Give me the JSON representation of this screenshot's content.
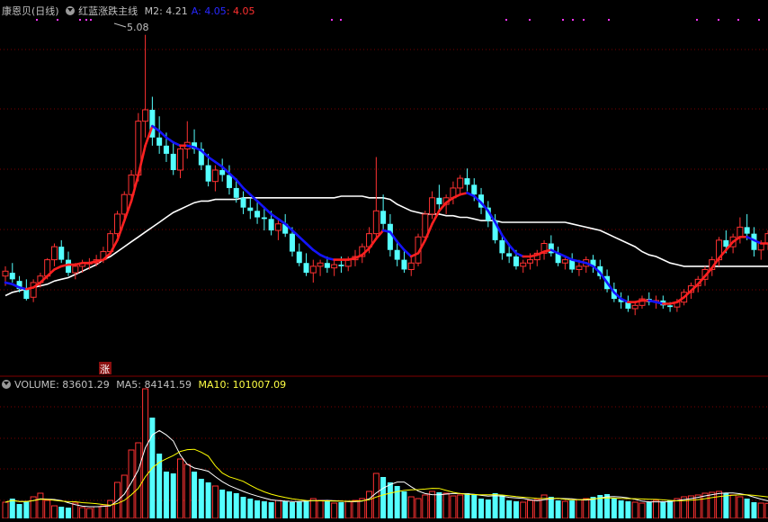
{
  "header": {
    "stock_name": "康恩贝(日线)",
    "indicator_name": "红蓝涨跌主线",
    "m2_label": "M2: 4.21",
    "a_label": "A: 4.05",
    "b_label": ": 4.05"
  },
  "annotations": {
    "high_label": "5.08",
    "zhang_marker": "涨"
  },
  "volume_header": {
    "volume_label": "VOLUME: 83601.29",
    "ma5_label": "MA5: 84141.59",
    "ma10_label": "MA10: 101007.09"
  },
  "colors": {
    "up": "#ff3232",
    "down": "#54ffff",
    "main_red": "#ff2020",
    "main_blue": "#1414ff",
    "long_ma": "#ffffff",
    "grid": "#7a0000",
    "dots": "#ff33ff",
    "ma10": "#ffff00",
    "ma5": "#ffffff"
  },
  "chart_data": [
    {
      "type": "candlestick",
      "price_range": [
        3.35,
        5.15
      ],
      "series": [
        {
          "name": "K",
          "ohlc": [
            [
              3.6,
              3.66,
              3.54,
              3.63
            ],
            [
              3.62,
              3.68,
              3.56,
              3.58
            ],
            [
              3.57,
              3.6,
              3.5,
              3.52
            ],
            [
              3.52,
              3.58,
              3.45,
              3.46
            ],
            [
              3.47,
              3.58,
              3.44,
              3.56
            ],
            [
              3.56,
              3.62,
              3.53,
              3.6
            ],
            [
              3.6,
              3.71,
              3.58,
              3.7
            ],
            [
              3.7,
              3.8,
              3.66,
              3.78
            ],
            [
              3.78,
              3.82,
              3.68,
              3.7
            ],
            [
              3.7,
              3.75,
              3.6,
              3.62
            ],
            [
              3.62,
              3.68,
              3.58,
              3.66
            ],
            [
              3.66,
              3.7,
              3.62,
              3.68
            ],
            [
              3.68,
              3.71,
              3.64,
              3.68
            ],
            [
              3.68,
              3.73,
              3.66,
              3.7
            ],
            [
              3.7,
              3.78,
              3.68,
              3.75
            ],
            [
              3.75,
              3.88,
              3.73,
              3.86
            ],
            [
              3.86,
              4.0,
              3.84,
              3.98
            ],
            [
              3.98,
              4.12,
              3.95,
              4.1
            ],
            [
              4.1,
              4.25,
              4.05,
              4.22
            ],
            [
              4.22,
              4.6,
              4.18,
              4.55
            ],
            [
              4.55,
              5.08,
              4.45,
              4.62
            ],
            [
              4.62,
              4.7,
              4.4,
              4.45
            ],
            [
              4.45,
              4.58,
              4.35,
              4.4
            ],
            [
              4.4,
              4.48,
              4.3,
              4.35
            ],
            [
              4.35,
              4.42,
              4.22,
              4.25
            ],
            [
              4.25,
              4.4,
              4.2,
              4.38
            ],
            [
              4.38,
              4.55,
              4.32,
              4.42
            ],
            [
              4.42,
              4.5,
              4.35,
              4.38
            ],
            [
              4.38,
              4.42,
              4.25,
              4.28
            ],
            [
              4.28,
              4.35,
              4.15,
              4.18
            ],
            [
              4.18,
              4.28,
              4.12,
              4.25
            ],
            [
              4.25,
              4.32,
              4.18,
              4.22
            ],
            [
              4.22,
              4.28,
              4.1,
              4.14
            ],
            [
              4.14,
              4.2,
              4.05,
              4.08
            ],
            [
              4.08,
              4.12,
              3.98,
              4.02
            ],
            [
              4.02,
              4.08,
              3.95,
              4.0
            ],
            [
              4.0,
              4.05,
              3.92,
              3.96
            ],
            [
              3.96,
              4.02,
              3.88,
              3.95
            ],
            [
              3.95,
              4.0,
              3.85,
              3.88
            ],
            [
              3.88,
              3.95,
              3.82,
              3.92
            ],
            [
              3.92,
              3.98,
              3.84,
              3.86
            ],
            [
              3.86,
              3.9,
              3.72,
              3.75
            ],
            [
              3.75,
              3.8,
              3.66,
              3.68
            ],
            [
              3.68,
              3.74,
              3.6,
              3.62
            ],
            [
              3.62,
              3.7,
              3.56,
              3.66
            ],
            [
              3.66,
              3.7,
              3.6,
              3.68
            ],
            [
              3.68,
              3.72,
              3.62,
              3.65
            ],
            [
              3.65,
              3.7,
              3.6,
              3.67
            ],
            [
              3.67,
              3.72,
              3.62,
              3.66
            ],
            [
              3.66,
              3.72,
              3.63,
              3.7
            ],
            [
              3.7,
              3.76,
              3.66,
              3.72
            ],
            [
              3.72,
              3.8,
              3.68,
              3.78
            ],
            [
              3.78,
              3.9,
              3.74,
              3.86
            ],
            [
              3.86,
              4.33,
              3.82,
              4.0
            ],
            [
              4.0,
              4.1,
              3.88,
              3.92
            ],
            [
              3.92,
              3.98,
              3.72,
              3.76
            ],
            [
              3.76,
              3.82,
              3.66,
              3.7
            ],
            [
              3.7,
              3.76,
              3.62,
              3.64
            ],
            [
              3.64,
              3.72,
              3.6,
              3.68
            ],
            [
              3.68,
              3.86,
              3.66,
              3.84
            ],
            [
              3.84,
              4.0,
              3.82,
              3.98
            ],
            [
              3.98,
              4.12,
              3.95,
              4.08
            ],
            [
              4.08,
              4.16,
              4.0,
              4.04
            ],
            [
              4.04,
              4.1,
              3.98,
              4.08
            ],
            [
              4.08,
              4.18,
              4.04,
              4.14
            ],
            [
              4.14,
              4.22,
              4.1,
              4.2
            ],
            [
              4.2,
              4.26,
              4.12,
              4.16
            ],
            [
              4.16,
              4.2,
              4.06,
              4.1
            ],
            [
              4.1,
              4.14,
              3.98,
              4.02
            ],
            [
              4.02,
              4.06,
              3.9,
              3.94
            ],
            [
              3.94,
              3.98,
              3.8,
              3.82
            ],
            [
              3.82,
              3.86,
              3.7,
              3.74
            ],
            [
              3.74,
              3.8,
              3.68,
              3.72
            ],
            [
              3.72,
              3.76,
              3.64,
              3.66
            ],
            [
              3.66,
              3.7,
              3.62,
              3.68
            ],
            [
              3.68,
              3.74,
              3.64,
              3.7
            ],
            [
              3.7,
              3.76,
              3.66,
              3.74
            ],
            [
              3.74,
              3.82,
              3.7,
              3.8
            ],
            [
              3.8,
              3.85,
              3.72,
              3.74
            ],
            [
              3.74,
              3.78,
              3.66,
              3.68
            ],
            [
              3.68,
              3.72,
              3.64,
              3.7
            ],
            [
              3.7,
              3.74,
              3.62,
              3.64
            ],
            [
              3.64,
              3.7,
              3.6,
              3.66
            ],
            [
              3.66,
              3.72,
              3.62,
              3.7
            ],
            [
              3.7,
              3.73,
              3.62,
              3.66
            ],
            [
              3.66,
              3.7,
              3.58,
              3.6
            ],
            [
              3.6,
              3.64,
              3.5,
              3.52
            ],
            [
              3.52,
              3.56,
              3.44,
              3.46
            ],
            [
              3.46,
              3.5,
              3.4,
              3.44
            ],
            [
              3.44,
              3.48,
              3.38,
              3.4
            ],
            [
              3.4,
              3.44,
              3.36,
              3.42
            ],
            [
              3.42,
              3.48,
              3.4,
              3.46
            ],
            [
              3.46,
              3.5,
              3.42,
              3.44
            ],
            [
              3.44,
              3.48,
              3.4,
              3.45
            ],
            [
              3.45,
              3.48,
              3.4,
              3.42
            ],
            [
              3.42,
              3.44,
              3.38,
              3.41
            ],
            [
              3.41,
              3.46,
              3.38,
              3.44
            ],
            [
              3.44,
              3.52,
              3.42,
              3.5
            ],
            [
              3.5,
              3.56,
              3.46,
              3.54
            ],
            [
              3.54,
              3.6,
              3.5,
              3.58
            ],
            [
              3.58,
              3.66,
              3.54,
              3.64
            ],
            [
              3.64,
              3.72,
              3.6,
              3.7
            ],
            [
              3.7,
              3.84,
              3.66,
              3.82
            ],
            [
              3.82,
              3.88,
              3.74,
              3.78
            ],
            [
              3.78,
              3.86,
              3.74,
              3.84
            ],
            [
              3.84,
              3.96,
              3.8,
              3.9
            ],
            [
              3.9,
              3.98,
              3.82,
              3.86
            ],
            [
              3.86,
              3.9,
              3.72,
              3.76
            ],
            [
              3.76,
              3.82,
              3.7,
              3.8
            ],
            [
              3.8,
              3.88,
              3.76,
              3.86
            ]
          ]
        }
      ]
    },
    {
      "type": "line",
      "title": "红蓝涨跌主线",
      "series": [
        {
          "name": "A",
          "values": [
            3.56,
            3.55,
            3.53,
            3.52,
            3.53,
            3.56,
            3.6,
            3.64,
            3.66,
            3.67,
            3.67,
            3.68,
            3.68,
            3.69,
            3.7,
            3.74,
            3.82,
            3.94,
            4.06,
            4.22,
            4.4,
            4.52,
            4.49,
            4.45,
            4.42,
            4.4,
            4.4,
            4.39,
            4.37,
            4.33,
            4.3,
            4.27,
            4.23,
            4.19,
            4.14,
            4.1,
            4.06,
            4.02,
            3.98,
            3.95,
            3.92,
            3.88,
            3.84,
            3.8,
            3.76,
            3.73,
            3.71,
            3.7,
            3.7,
            3.7,
            3.71,
            3.73,
            3.77,
            3.83,
            3.88,
            3.87,
            3.81,
            3.76,
            3.72,
            3.74,
            3.82,
            3.92,
            4.0,
            4.05,
            4.08,
            4.1,
            4.11,
            4.09,
            4.05,
            4.0,
            3.93,
            3.85,
            3.79,
            3.74,
            3.72,
            3.72,
            3.73,
            3.75,
            3.76,
            3.74,
            3.72,
            3.7,
            3.69,
            3.68,
            3.66,
            3.62,
            3.56,
            3.5,
            3.46,
            3.44,
            3.44,
            3.45,
            3.45,
            3.44,
            3.43,
            3.43,
            3.44,
            3.47,
            3.51,
            3.55,
            3.6,
            3.65,
            3.71,
            3.76,
            3.81,
            3.84,
            3.84,
            3.82,
            3.8,
            3.8
          ]
        }
      ]
    },
    {
      "type": "line",
      "series": [
        {
          "values": [
            3.48,
            3.5,
            3.51,
            3.52,
            3.53,
            3.54,
            3.55,
            3.57,
            3.58,
            3.59,
            3.61,
            3.63,
            3.65,
            3.67,
            3.7,
            3.72,
            3.75,
            3.78,
            3.81,
            3.84,
            3.87,
            3.9,
            3.93,
            3.96,
            3.99,
            4.01,
            4.03,
            4.05,
            4.06,
            4.06,
            4.07,
            4.07,
            4.07,
            4.07,
            4.08,
            4.08,
            4.08,
            4.08,
            4.08,
            4.08,
            4.08,
            4.08,
            4.08,
            4.08,
            4.08,
            4.08,
            4.08,
            4.08,
            4.09,
            4.09,
            4.09,
            4.09,
            4.08,
            4.08,
            4.08,
            4.07,
            4.04,
            4.02,
            4.0,
            3.99,
            3.98,
            3.98,
            3.98,
            3.97,
            3.97,
            3.96,
            3.96,
            3.95,
            3.94,
            3.94,
            3.94,
            3.93,
            3.93,
            3.93,
            3.93,
            3.93,
            3.93,
            3.93,
            3.93,
            3.93,
            3.93,
            3.92,
            3.91,
            3.9,
            3.89,
            3.88,
            3.86,
            3.84,
            3.82,
            3.8,
            3.78,
            3.75,
            3.73,
            3.72,
            3.7,
            3.68,
            3.67,
            3.66,
            3.66,
            3.66,
            3.66,
            3.66,
            3.66,
            3.66,
            3.66,
            3.66,
            3.66,
            3.66,
            3.66,
            3.66
          ]
        }
      ]
    },
    {
      "type": "bar",
      "title": "VOLUME",
      "series": [
        {
          "name": "VOLUME",
          "values": [
            90000,
            110000,
            80000,
            95000,
            120000,
            140000,
            100000,
            70000,
            65000,
            60000,
            85000,
            60000,
            55000,
            65000,
            70000,
            100000,
            200000,
            240000,
            380000,
            420000,
            720000,
            560000,
            360000,
            260000,
            250000,
            330000,
            300000,
            260000,
            220000,
            200000,
            180000,
            160000,
            150000,
            140000,
            120000,
            110000,
            100000,
            95000,
            90000,
            100000,
            95000,
            90000,
            95000,
            100000,
            110000,
            100000,
            95000,
            85000,
            90000,
            95000,
            100000,
            110000,
            150000,
            250000,
            230000,
            200000,
            180000,
            150000,
            120000,
            110000,
            130000,
            150000,
            145000,
            140000,
            125000,
            130000,
            140000,
            135000,
            110000,
            105000,
            140000,
            130000,
            100000,
            95000,
            90000,
            100000,
            105000,
            130000,
            120000,
            100000,
            95000,
            100000,
            105000,
            110000,
            120000,
            130000,
            135000,
            110000,
            100000,
            95000,
            90000,
            85000,
            90000,
            100000,
            95000,
            100000,
            110000,
            120000,
            125000,
            130000,
            140000,
            145000,
            150000,
            140000,
            130000,
            120000,
            110000,
            90000,
            85000,
            83601
          ]
        },
        {
          "name": "MA5",
          "values": []
        },
        {
          "name": "MA10",
          "values": []
        }
      ]
    }
  ]
}
